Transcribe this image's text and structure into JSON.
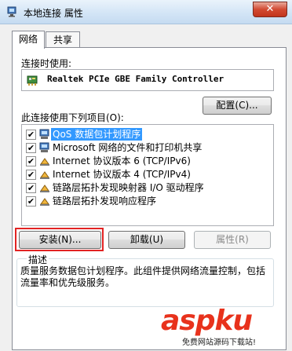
{
  "window": {
    "title": "本地连接 属性",
    "close_label": "✕"
  },
  "tabs": [
    {
      "label": "网络",
      "active": true
    },
    {
      "label": "共享",
      "active": false
    }
  ],
  "connect_using": {
    "label": "连接时使用:",
    "adapter": "Realtek PCIe GBE Family Controller",
    "configure_button": "配置(C)..."
  },
  "items_section": {
    "label": "此连接使用下列项目(O):",
    "items": [
      {
        "text": "QoS 数据包计划程序",
        "checked": true,
        "selected": true,
        "icon": "network-client-icon"
      },
      {
        "text": "Microsoft 网络的文件和打印机共享",
        "checked": true,
        "selected": false,
        "icon": "network-client-icon"
      },
      {
        "text": "Internet 协议版本 6 (TCP/IPv6)",
        "checked": true,
        "selected": false,
        "icon": "protocol-icon"
      },
      {
        "text": "Internet 协议版本 4 (TCP/IPv4)",
        "checked": true,
        "selected": false,
        "icon": "protocol-icon"
      },
      {
        "text": "链路层拓扑发现映射器 I/O 驱动程序",
        "checked": true,
        "selected": false,
        "icon": "protocol-icon"
      },
      {
        "text": "链路层拓扑发现响应程序",
        "checked": true,
        "selected": false,
        "icon": "protocol-icon"
      }
    ]
  },
  "buttons": {
    "install": "安装(N)...",
    "uninstall": "卸载(U)",
    "properties": "属性(R)"
  },
  "description": {
    "label": "描述",
    "text": "质量服务数据包计划程序。此组件提供网络流量控制，包括流量率和优先级服务。"
  },
  "watermark": {
    "main": "aspku",
    "sub": "免费网站源码下载站!"
  },
  "colors": {
    "selection": "#3399ff",
    "highlight_frame": "#e22323",
    "titlebar": "#d3e5f6"
  }
}
